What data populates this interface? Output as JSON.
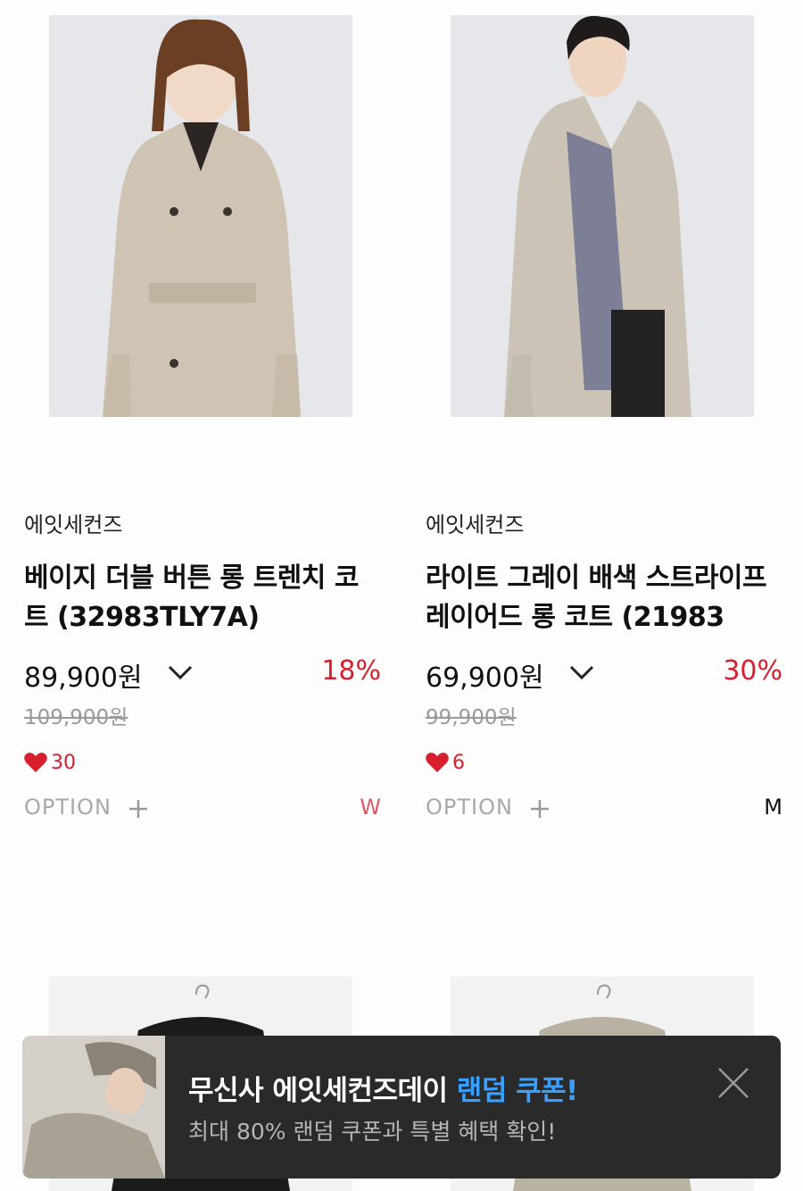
{
  "products": [
    {
      "brand": "에잇세컨즈",
      "title": "베이지 더블 버튼 롱 트렌치 코트 (32983TLY7A)",
      "price": "89,900원",
      "discount": "18%",
      "original_price": "109,900원",
      "likes": "30",
      "option_label": "OPTION",
      "gender": "W"
    },
    {
      "brand": "에잇세컨즈",
      "title": "라이트 그레이 배색 스트라이프 레이어드 롱 코트 (21983",
      "price": "69,900원",
      "discount": "30%",
      "original_price": "99,900원",
      "likes": "6",
      "option_label": "OPTION",
      "gender": "M"
    }
  ],
  "banner": {
    "title_main": "무신사 에잇세컨즈데이 ",
    "title_highlight": "랜덤 쿠폰!",
    "subtitle": "최대 80% 랜덤 쿠폰과 특별 혜택 확인!"
  },
  "colors": {
    "discount": "#d71f2d",
    "gender_w": "#e0566b",
    "banner_bg": "#2a2a2a",
    "banner_highlight": "#3aa0ff"
  },
  "icons": {
    "chevron": "chevron-down-icon",
    "heart": "heart-icon",
    "plus": "plus-icon",
    "close": "close-icon"
  }
}
